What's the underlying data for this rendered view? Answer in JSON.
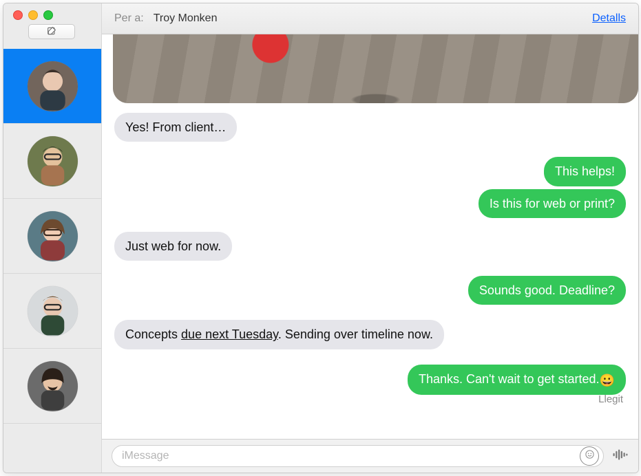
{
  "header": {
    "to_label": "Per a:",
    "to_name": "Troy Monken",
    "details_label": "Detalls"
  },
  "sidebar": {
    "compose_label": "Compose",
    "conversations": [
      {
        "selected": true
      },
      {
        "selected": false
      },
      {
        "selected": false
      },
      {
        "selected": false
      },
      {
        "selected": false
      }
    ]
  },
  "thread": {
    "messages": [
      {
        "type": "image",
        "side": "left"
      },
      {
        "type": "text",
        "side": "left",
        "text": "Yes! From client…"
      },
      {
        "type": "text",
        "side": "right",
        "text": "This helps!"
      },
      {
        "type": "text",
        "side": "right",
        "text": "Is this for web or print?"
      },
      {
        "type": "text",
        "side": "left",
        "text": "Just web for now."
      },
      {
        "type": "text",
        "side": "right",
        "text": "Sounds good. Deadline?"
      },
      {
        "type": "text",
        "side": "left",
        "text_parts": [
          "Concepts ",
          {
            "u": "due next Tuesday"
          },
          ". Sending over timeline now."
        ]
      },
      {
        "type": "text",
        "side": "right",
        "text": "Thanks. Can't wait to get started.",
        "emoji": "😀"
      }
    ],
    "read_receipt": "Llegit"
  },
  "composer": {
    "placeholder": "iMessage"
  }
}
